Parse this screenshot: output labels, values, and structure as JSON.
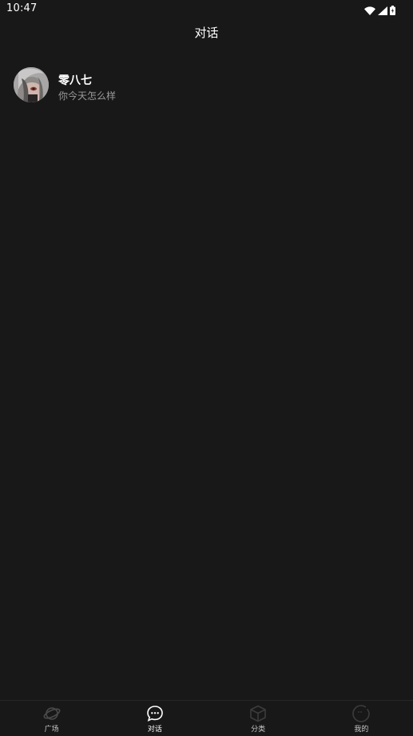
{
  "status_bar": {
    "time": "10:47",
    "icons": [
      "wifi-icon",
      "cell-signal-icon",
      "battery-icon"
    ]
  },
  "header": {
    "title": "对话"
  },
  "conversations": [
    {
      "name": "零八七",
      "preview": "你今天怎么样",
      "avatar": "avatar-image"
    }
  ],
  "tabs": [
    {
      "label": "广场",
      "icon": "planet-icon",
      "active": false
    },
    {
      "label": "对话",
      "icon": "chat-bubble-icon",
      "active": true
    },
    {
      "label": "分类",
      "icon": "cube-icon",
      "active": false
    },
    {
      "label": "我的",
      "icon": "profile-face-icon",
      "active": false
    }
  ],
  "colors": {
    "background": "#181818",
    "text_primary": "#ffffff",
    "text_secondary": "#9a9a9a",
    "tab_inactive_icon": "#3c3c3c"
  }
}
